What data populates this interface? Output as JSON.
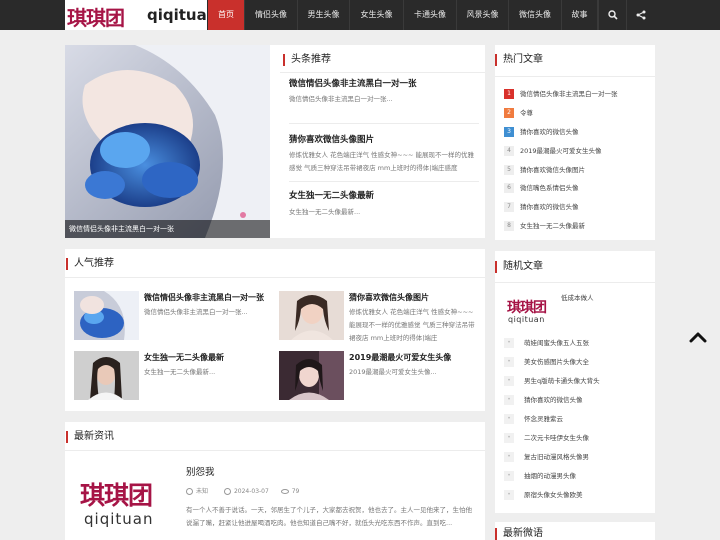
{
  "nav": {
    "logo_cn": "琪琪团",
    "logo_en": "qiqituan",
    "items": [
      "首页",
      "情侣头像",
      "男生头像",
      "女生头像",
      "卡通头像",
      "风景头像",
      "微信头像",
      "故事"
    ]
  },
  "headline": {
    "section_title": "头条推荐",
    "featured_caption": "微信情侣头像非主流黑白一对一张",
    "items": [
      {
        "title": "微信情侣头像非主流黑白一对一张",
        "desc": "微信情侣头像非主流黑白一对一张..."
      },
      {
        "title": "猜你喜欢微信头像图片",
        "desc": "修炼优雅女人 花色端庄洋气 性感女神~~~ 能展现不一样的优雅感觉 气质三种穿法吊带裙夜店 mm上班时的得体|端庄惑度"
      },
      {
        "title": "女生独一无二头像最新",
        "desc": "女生独一无二头像最新..."
      }
    ]
  },
  "popular": {
    "section_title": "人气推荐",
    "items": [
      {
        "title": "微信情侣头像非主流黑白一对一张",
        "desc": "微信情侣头像非主流黑白一对一张..."
      },
      {
        "title": "猜你喜欢微信头像图片",
        "desc": "修炼优雅女人 花色端庄洋气 性感女神~~~ 能展现不一样的优雅感觉 气质三种穿法吊带裙夜店 mm上班时的得体|端庄"
      },
      {
        "title": "女生独一无二头像最新",
        "desc": "女生独一无二头像最新..."
      },
      {
        "title": "2019最潮最火可爱女生头像",
        "desc": "2019最潮最火可爱女生头像..."
      }
    ]
  },
  "news": {
    "section_title": "最新资讯",
    "logo_cn": "琪琪团",
    "logo_en": "qiqituan",
    "title": "别怨我",
    "author": "未知",
    "date": "2024-03-07",
    "views": "79",
    "excerpt": "有一个人不善于说话。一天，邻居生了个儿子，大家都去祝贺，他也去了。主人一见他来了，生怕他说漏了嘴，赶紧让他进屋喝酒吃肉。他也知道自己嘴不好，就低头光吃东西不作声。直到吃..."
  },
  "hot": {
    "section_title": "热门文章",
    "items": [
      "微信情侣头像非主流黑白一对一张",
      "令尊",
      "猜你喜欢的微信头像",
      "2019最潮最火可爱女生头像",
      "猜你喜欢微信头像图片",
      "微信嘴色系情侣头像",
      "猜你喜欢的微信头像",
      "女生独一无二头像最新"
    ],
    "numbers": [
      "1",
      "2",
      "3",
      "4",
      "5",
      "6",
      "7",
      "8"
    ],
    "number_colors": [
      "#d9312b",
      "#f07b3f",
      "#3f8fd2",
      "#eeeeee",
      "#eeeeee",
      "#eeeeee",
      "#eeeeee",
      "#eeeeee"
    ]
  },
  "random": {
    "section_title": "随机文章",
    "logo_cn": "琪琪团",
    "logo_en": "qiqituan",
    "feature_title": "低成本做人",
    "items": [
      "萌娃闺蜜头像五人五张",
      "美女伤感图片头像大全",
      "男生q版萌卡通头像大背头",
      "猜你喜欢的微信头像",
      "怀念灵雅紫云",
      "二次元卡哇伊女生头像",
      "复古旧动漫风格头像男",
      "抽烟的动漫男头像",
      "原宿头像女头像欧美"
    ]
  },
  "weibo": {
    "section_title": "最新微语"
  },
  "colors": {
    "accent": "#c9302c",
    "brand": "#a61446",
    "nav_bg": "#2a2a2a"
  },
  "icons": {
    "search": "search-icon",
    "share": "share-icon",
    "to_top": "chevron-up-icon"
  }
}
